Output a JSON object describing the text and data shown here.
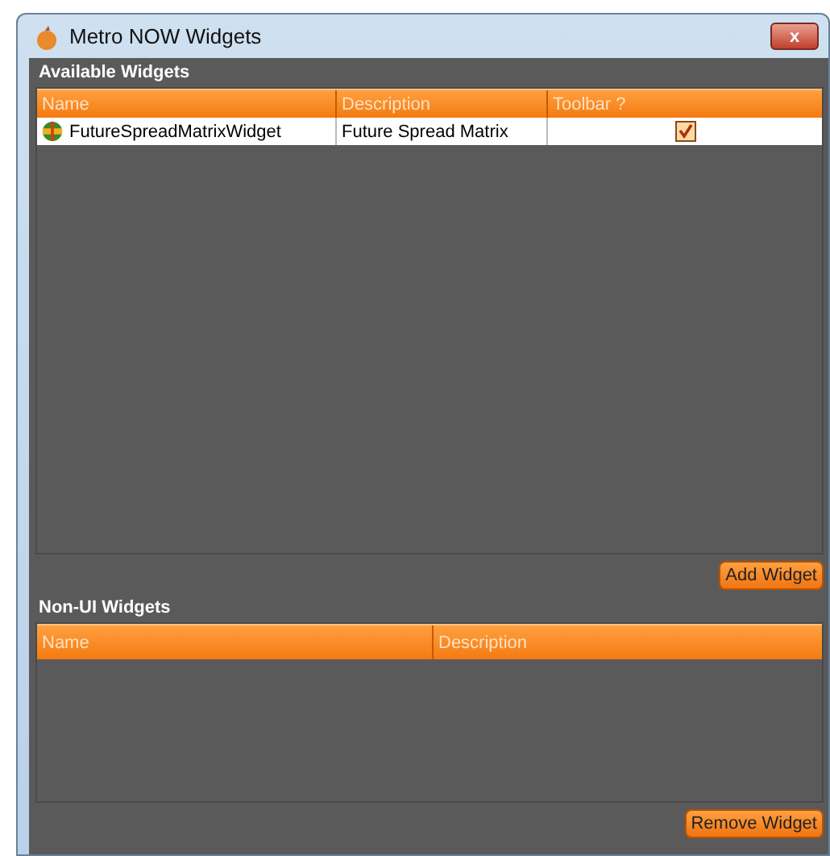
{
  "window": {
    "title": "Metro NOW Widgets",
    "close_label": "x"
  },
  "available": {
    "title": "Available Widgets",
    "columns": [
      "Name",
      "Description",
      "Toolbar ?"
    ],
    "rows": [
      {
        "name": "FutureSpreadMatrixWidget",
        "description": "Future Spread Matrix",
        "toolbar": true
      }
    ],
    "button": "Add Widget"
  },
  "non_ui": {
    "title": "Non-UI Widgets",
    "columns": [
      "Name",
      "Description"
    ],
    "button": "Remove Widget"
  }
}
